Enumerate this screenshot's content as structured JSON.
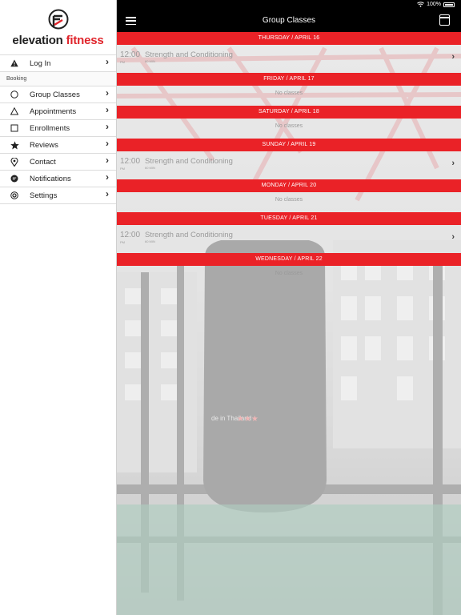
{
  "status_bar": {
    "battery": "100%"
  },
  "brand": {
    "name_part1": "elevation",
    "name_part2": " fitness",
    "accent": "#e0242b"
  },
  "sidebar": {
    "login": {
      "label": "Log In",
      "icon": "warning-icon"
    },
    "section": "Booking",
    "items": [
      {
        "label": "Group Classes",
        "icon": "circle-icon"
      },
      {
        "label": "Appointments",
        "icon": "triangle-icon"
      },
      {
        "label": "Enrollments",
        "icon": "square-icon"
      },
      {
        "label": "Reviews",
        "icon": "star-icon"
      },
      {
        "label": "Contact",
        "icon": "map-pin-icon"
      },
      {
        "label": "Notifications",
        "icon": "chat-bubble-icon"
      },
      {
        "label": "Settings",
        "icon": "settings-icon"
      }
    ]
  },
  "header": {
    "title": "Group Classes"
  },
  "schedule": {
    "days": [
      {
        "label": "THURSDAY / APRIL 16",
        "class_time": "12:00",
        "class_ampm": "PM",
        "class_name": "Strength and Conditioning",
        "class_sub": "60 MIN"
      },
      {
        "label": "FRIDAY / APRIL 17",
        "empty": "No classes"
      },
      {
        "label": "SATURDAY / APRIL 18",
        "empty": "No classes"
      },
      {
        "label": "SUNDAY / APRIL 19",
        "class_time": "12:00",
        "class_ampm": "PM",
        "class_name": "Strength and Conditioning",
        "class_sub": "60 MIN"
      },
      {
        "label": "MONDAY / APRIL 20",
        "empty": "No classes"
      },
      {
        "label": "TUESDAY / APRIL 21",
        "class_time": "12:00",
        "class_ampm": "PM",
        "class_name": "Strength and Conditioning",
        "class_sub": "60 MIN"
      },
      {
        "label": "WEDNESDAY / APRIL 22",
        "empty": "No classes"
      }
    ]
  },
  "colors": {
    "header_red": "#ea2227",
    "topbar": "#000000"
  }
}
